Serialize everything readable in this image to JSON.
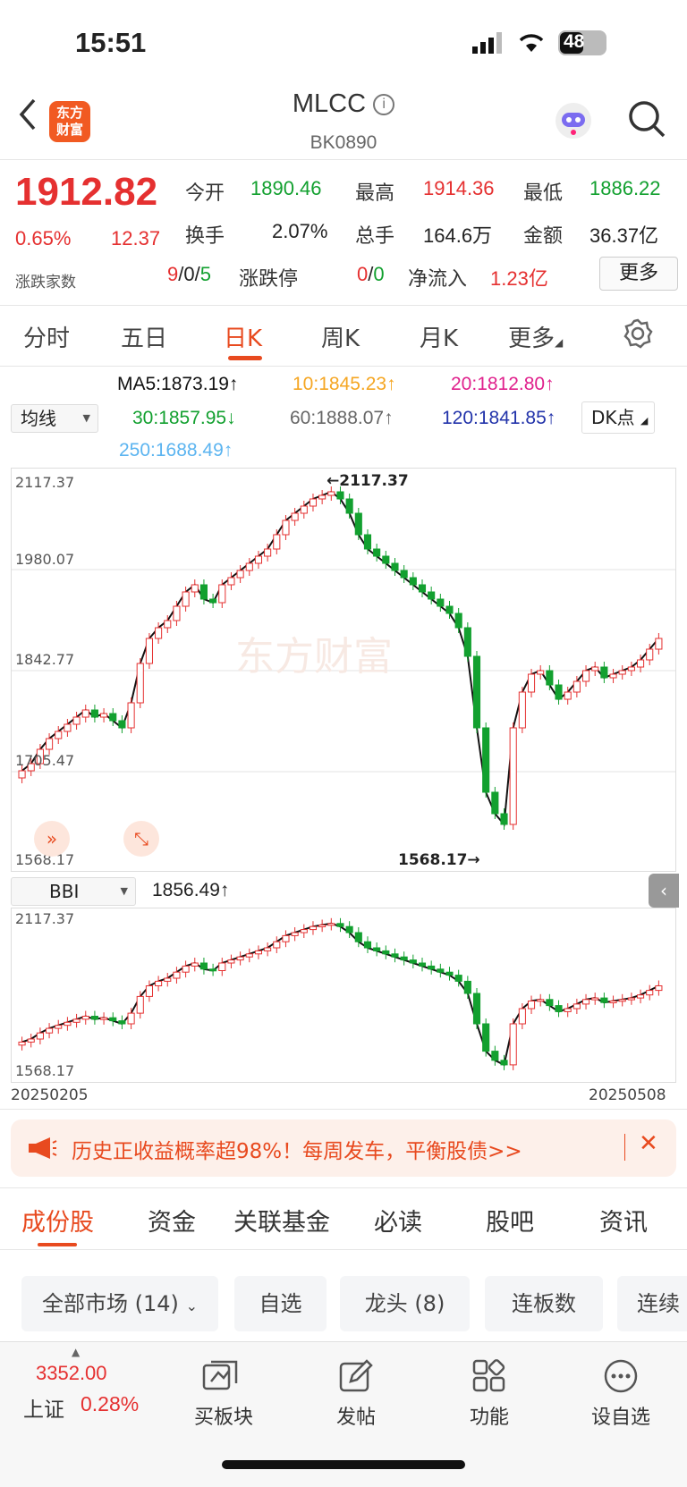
{
  "status_bar": {
    "time": "15:51",
    "battery": "48"
  },
  "header": {
    "logo_text_1": "东方",
    "logo_text_2": "财富",
    "title": "MLCC",
    "code": "BK0890"
  },
  "quote": {
    "price": "1912.82",
    "change_pct": "0.65%",
    "change": "12.37",
    "adv_label": "涨跌家数",
    "adv_up": "9",
    "adv_flat": "0",
    "adv_down": "5",
    "open_label": "今开",
    "open": "1890.46",
    "high_label": "最高",
    "high": "1914.36",
    "low_label": "最低",
    "low": "1886.22",
    "turnover_label": "换手",
    "turnover": "2.07%",
    "volume_label": "总手",
    "volume": "164.6万",
    "amount_label": "金额",
    "amount": "36.37亿",
    "limit_label": "涨跌停",
    "limit_up": "0",
    "limit_down": "0",
    "netflow_label": "净流入",
    "netflow": "1.23亿",
    "more_btn": "更多"
  },
  "tabs": [
    "分时",
    "五日",
    "日K",
    "周K",
    "月K",
    "更多"
  ],
  "active_tab": "日K",
  "ma": {
    "select": "均线",
    "ma5": "MA5:1873.19↑",
    "ma10": "10:1845.23↑",
    "ma20": "20:1812.80↑",
    "ma30": "30:1857.95↓",
    "ma60": "60:1888.07↑",
    "ma120": "120:1841.85↑",
    "ma250": "250:1688.49↑",
    "dk_select": "DK点"
  },
  "main_chart": {
    "y_labels": [
      "2117.37",
      "1980.07",
      "1842.77",
      "1705.47",
      "1568.17"
    ],
    "max_annotation": "←2117.37",
    "min_annotation": "1568.17→",
    "watermark": "东方财富"
  },
  "bbi": {
    "select": "BBI",
    "value": "1856.49↑",
    "y_top": "2117.37",
    "y_bottom": "1568.17",
    "date_start": "20250205",
    "date_end": "20250508"
  },
  "chart_data": {
    "type": "candlestick",
    "x_range": [
      "20250205",
      "20250508"
    ],
    "ylim": [
      1568.17,
      2117.37
    ],
    "max": 2117.37,
    "min": 1568.17
  },
  "notice": {
    "text": "历史正收益概率超98%！每周发车，平衡股债>>"
  },
  "bottom_tabs": [
    "成份股",
    "资金",
    "关联基金",
    "必读",
    "股吧",
    "资讯"
  ],
  "chips": [
    "全部市场 (14)",
    "自选",
    "龙头 (8)",
    "连板数",
    "连续"
  ],
  "bottom_bar": {
    "index_value": "3352.00",
    "index_name": "上证",
    "index_pct": "0.28%",
    "items": [
      "买板块",
      "发帖",
      "功能",
      "设自选"
    ]
  },
  "colors": {
    "up": "#e53030",
    "down": "#12a02f",
    "accent": "#e84a1f"
  }
}
